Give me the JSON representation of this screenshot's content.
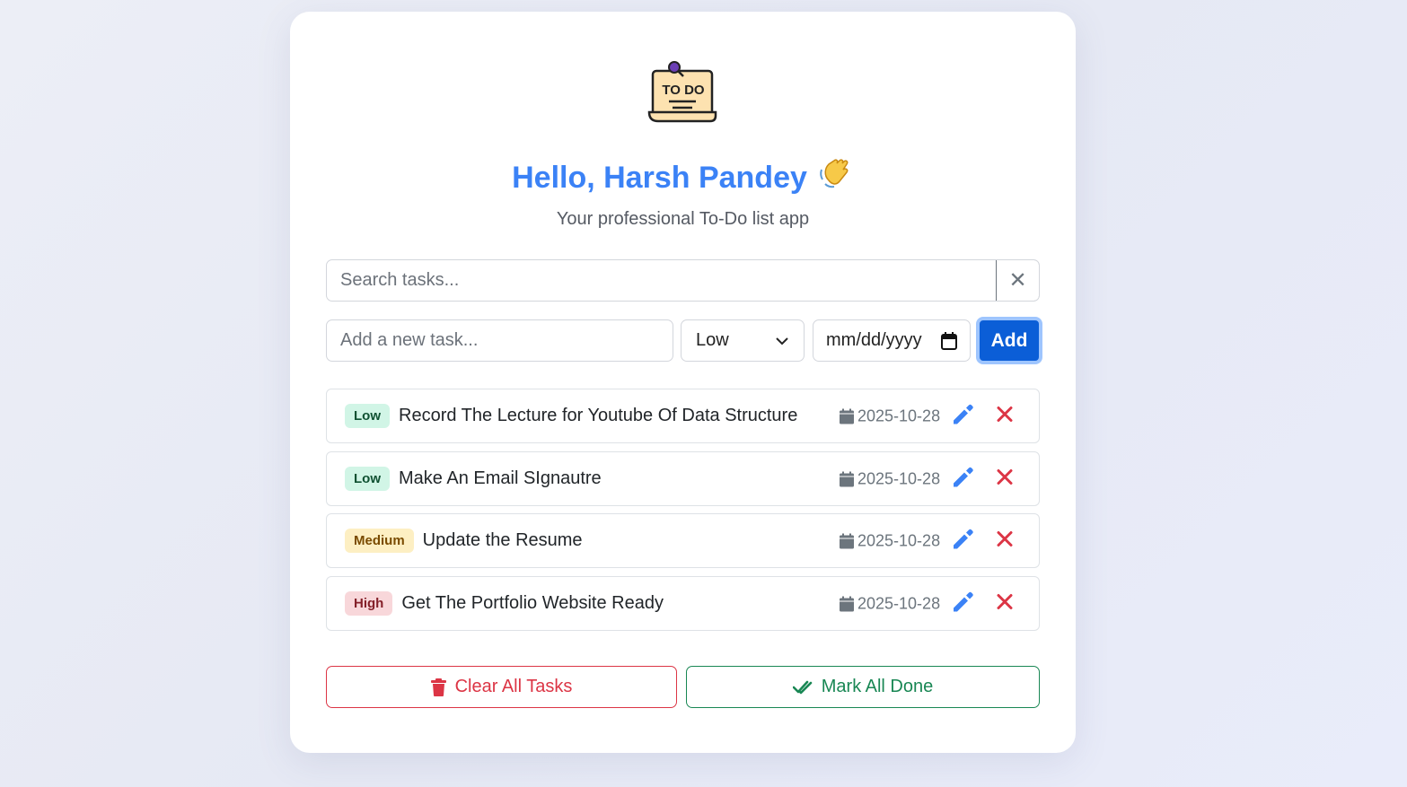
{
  "header": {
    "logo_text": "TO DO",
    "greeting": "Hello, Harsh Pandey",
    "wave_emoji": "👋",
    "subtitle": "Your professional To-Do list app"
  },
  "search": {
    "placeholder": "Search tasks...",
    "value": "",
    "clear_symbol": "✕"
  },
  "new_task": {
    "placeholder": "Add a new task...",
    "value": "",
    "priority_selected": "Low",
    "date_placeholder": "mm/dd/yyyy",
    "add_label": "Add"
  },
  "tasks": [
    {
      "priority": "Low",
      "title": "Record The Lecture for Youtube Of Data Structure",
      "date": "2025-10-28"
    },
    {
      "priority": "Low",
      "title": "Make An Email SIgnautre",
      "date": "2025-10-28"
    },
    {
      "priority": "Medium",
      "title": "Update the Resume",
      "date": "2025-10-28"
    },
    {
      "priority": "High",
      "title": "Get The Portfolio Website Ready",
      "date": "2025-10-28"
    }
  ],
  "actions": {
    "clear_all_label": "Clear All Tasks",
    "mark_all_label": "Mark All Done"
  },
  "colors": {
    "accent": "#3b82f6",
    "add_button": "#0b5ed7",
    "danger": "#dc3545",
    "success": "#198754"
  }
}
